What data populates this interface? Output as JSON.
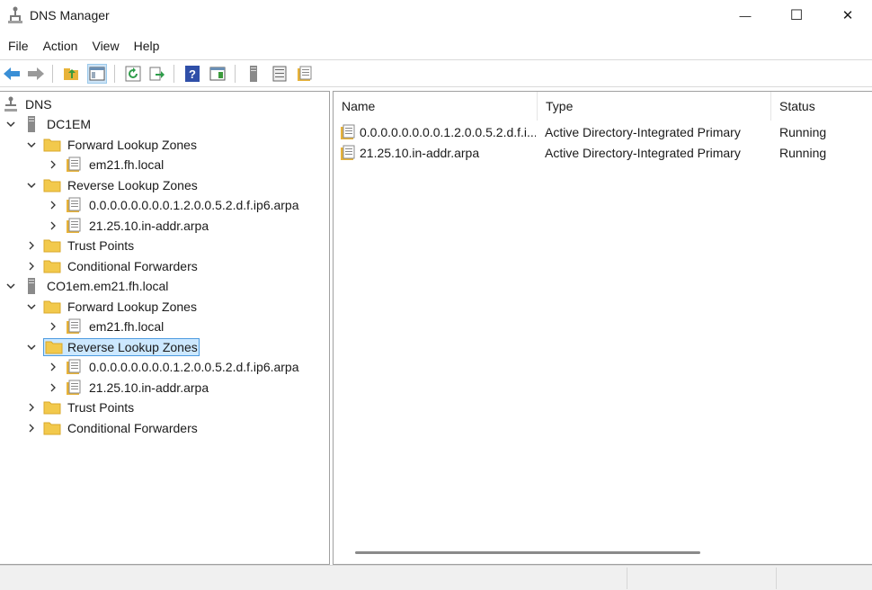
{
  "window": {
    "title": "DNS Manager",
    "minimize_glyph": "—",
    "maximize_glyph": "☐",
    "close_glyph": "✕"
  },
  "menu": [
    "File",
    "Action",
    "View",
    "Help"
  ],
  "toolbar": {
    "buttons": [
      "back-arrow-icon",
      "forward-arrow-icon",
      "up-folder-icon",
      "show-hide-console-tree-icon",
      "refresh-icon",
      "export-list-icon",
      "help-icon",
      "action-pane-icon",
      "server-icon",
      "list-view-icon",
      "zone-properties-icon"
    ]
  },
  "tree": {
    "root": "DNS",
    "servers": [
      {
        "name": "DC1EM",
        "forward_zones_label": "Forward Lookup Zones",
        "forward_zones": [
          "em21.fh.local"
        ],
        "reverse_zones_label": "Reverse Lookup Zones",
        "reverse_zones": [
          "0.0.0.0.0.0.0.0.1.2.0.0.5.2.d.f.ip6.arpa",
          "21.25.10.in-addr.arpa"
        ],
        "trust_points_label": "Trust Points",
        "conditional_forwarders_label": "Conditional Forwarders"
      },
      {
        "name": "CO1em.em21.fh.local",
        "forward_zones_label": "Forward Lookup Zones",
        "forward_zones": [
          "em21.fh.local"
        ],
        "reverse_zones_label": "Reverse Lookup Zones",
        "reverse_zones": [
          "0.0.0.0.0.0.0.0.1.2.0.0.5.2.d.f.ip6.arpa",
          "21.25.10.in-addr.arpa"
        ],
        "trust_points_label": "Trust Points",
        "conditional_forwarders_label": "Conditional Forwarders"
      }
    ],
    "selected": "CO1em.em21.fh.local / Reverse Lookup Zones"
  },
  "list": {
    "columns": [
      "Name",
      "Type",
      "Status"
    ],
    "rows": [
      {
        "name": "0.0.0.0.0.0.0.0.1.2.0.0.5.2.d.f.i...",
        "type": "Active Directory-Integrated Primary",
        "status": "Running"
      },
      {
        "name": "21.25.10.in-addr.arpa",
        "type": "Active Directory-Integrated Primary",
        "status": "Running"
      }
    ]
  },
  "colors": {
    "selection_bg": "#cce8ff",
    "selection_border": "#4d9be0",
    "folder": "#f2c94c",
    "toolbar_active": "#cde4f7"
  }
}
